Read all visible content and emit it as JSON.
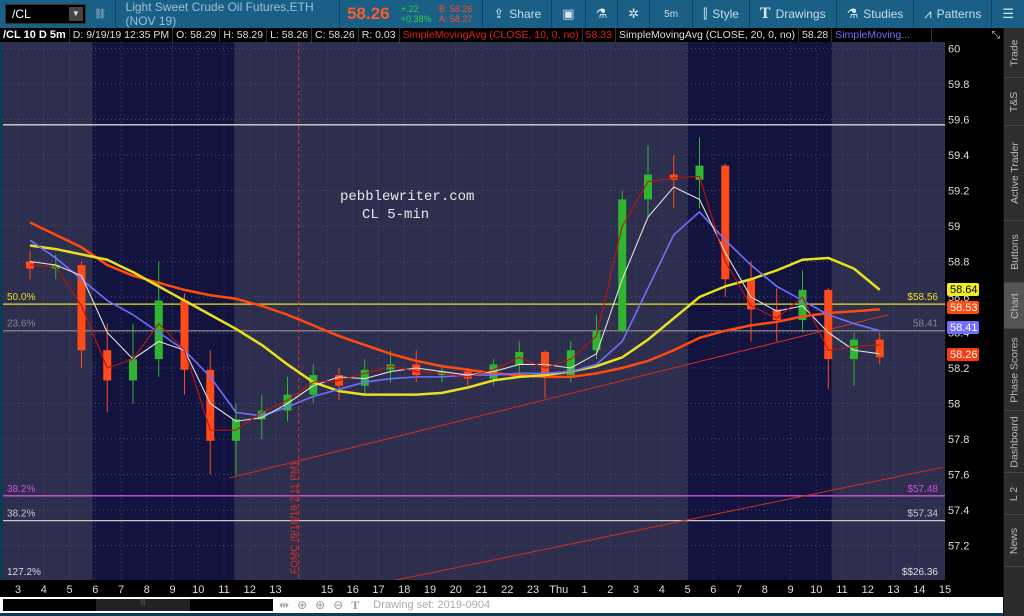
{
  "toolbar": {
    "symbol": "/CL",
    "description": "Light Sweet Crude Oil Futures,ETH (NOV 19)",
    "last": "58.26",
    "change": "+.22",
    "change_pct": "+0.38%",
    "bid": "B: 58.26",
    "ask": "A: 58.27",
    "share": "Share",
    "timeframe": "5m",
    "style": "Style",
    "drawings": "Drawings",
    "studies": "Studies",
    "patterns": "Patterns"
  },
  "status": {
    "title": "/CL 10 D 5m",
    "date": "D: 9/19/19 12:35 PM",
    "open": "O: 58.29",
    "high": "H: 58.29",
    "low": "L: 58.26",
    "close": "C: 58.26",
    "range": "R: 0.03",
    "study1": "SimpleMovingAvg (CLOSE, 10, 0, no)",
    "study1_value": "58.33",
    "study2": "SimpleMovingAvg (CLOSE, 20, 0, no)",
    "study2_value": "58.28",
    "study3": "SimpleMoving..."
  },
  "sidebar": [
    "Trade",
    "T&S",
    "Active Trader",
    "Buttons",
    "Chart",
    "Phase Scores",
    "Dashboard",
    "L 2",
    "News"
  ],
  "sidebar_selected": "Chart",
  "bottom": {
    "drawing_set": "Drawing set: 2019-0904"
  },
  "watermark": [
    "pebblewriter.com",
    "CL 5-min"
  ],
  "chart_data": {
    "type": "candlestick",
    "colors": {
      "background": "#2e2e4e",
      "session_band": "#13133f",
      "up": "#2fb52f",
      "down": "#ff4a1a"
    },
    "ylim": [
      57.0,
      60.0
    ],
    "y_ticks": [
      60,
      59.8,
      59.6,
      59.4,
      59.2,
      59,
      58.8,
      58.6,
      58.4,
      58.2,
      58,
      57.8,
      57.6,
      57.4,
      57.2
    ],
    "x_labels": [
      "3",
      "4",
      "5",
      "6",
      "7",
      "8",
      "9",
      "10",
      "11",
      "12",
      "13",
      "",
      "15",
      "16",
      "17",
      "18",
      "19",
      "20",
      "21",
      "22",
      "23",
      "Thu",
      "1",
      "2",
      "3",
      "4",
      "5",
      "6",
      "7",
      "8",
      "9",
      "10",
      "11",
      "12",
      "13",
      "14",
      "15"
    ],
    "session_bands": [
      [
        2.9,
        8.4
      ],
      [
        26.0,
        31.6
      ]
    ],
    "ohlc": [
      [
        58.8,
        58.86,
        58.7,
        58.76
      ],
      [
        58.76,
        58.84,
        58.7,
        58.78
      ],
      [
        58.78,
        58.8,
        58.2,
        58.3
      ],
      [
        58.3,
        58.45,
        57.95,
        58.13
      ],
      [
        58.13,
        58.45,
        58.0,
        58.25
      ],
      [
        58.25,
        58.8,
        58.15,
        58.58
      ],
      [
        58.58,
        58.62,
        58.05,
        58.19
      ],
      [
        58.19,
        58.3,
        57.6,
        57.79
      ],
      [
        57.79,
        58.0,
        57.6,
        57.91
      ],
      [
        57.91,
        58.05,
        57.8,
        57.96
      ],
      [
        57.96,
        58.15,
        57.9,
        58.05
      ],
      [
        58.05,
        58.22,
        58.0,
        58.16
      ],
      [
        58.16,
        58.2,
        58.02,
        58.1
      ],
      [
        58.1,
        58.25,
        58.05,
        58.19
      ],
      [
        58.19,
        58.3,
        58.12,
        58.22
      ],
      [
        58.22,
        58.3,
        58.12,
        58.16
      ],
      [
        58.16,
        58.22,
        58.12,
        58.18
      ],
      [
        58.18,
        58.2,
        58.1,
        58.14
      ],
      [
        58.14,
        58.25,
        58.1,
        58.22
      ],
      [
        58.22,
        58.35,
        58.15,
        58.29
      ],
      [
        58.29,
        58.3,
        58.03,
        58.16
      ],
      [
        58.16,
        58.35,
        58.12,
        58.3
      ],
      [
        58.3,
        58.5,
        58.25,
        58.41
      ],
      [
        58.41,
        59.2,
        58.4,
        59.15
      ],
      [
        59.15,
        59.45,
        59.05,
        59.29
      ],
      [
        59.29,
        59.4,
        59.1,
        59.26
      ],
      [
        59.26,
        59.5,
        59.1,
        59.34
      ],
      [
        59.34,
        59.35,
        58.6,
        58.7
      ],
      [
        58.7,
        58.8,
        58.35,
        58.53
      ],
      [
        58.53,
        58.65,
        58.35,
        58.47
      ],
      [
        58.47,
        58.75,
        58.4,
        58.64
      ],
      [
        58.64,
        58.65,
        58.08,
        58.25
      ],
      [
        58.25,
        58.4,
        58.1,
        58.36
      ],
      [
        58.36,
        58.4,
        58.22,
        58.26
      ]
    ],
    "series": [
      {
        "color": "#ff4a10",
        "values": [
          59.02,
          58.95,
          58.88,
          58.78,
          58.72,
          58.68,
          58.64,
          58.61,
          58.59,
          58.55,
          58.5,
          58.44,
          58.38,
          58.33,
          58.28,
          58.24,
          58.21,
          58.19,
          58.17,
          58.16,
          58.15,
          58.15,
          58.17,
          58.2,
          58.24,
          58.3,
          58.37,
          58.41,
          58.44,
          58.46,
          58.49,
          58.51,
          58.52,
          58.53
        ]
      },
      {
        "color": "#e8e020",
        "values": [
          58.89,
          58.87,
          58.84,
          58.81,
          58.74,
          58.66,
          58.58,
          58.5,
          58.42,
          58.33,
          58.22,
          58.12,
          58.07,
          58.05,
          58.05,
          58.05,
          58.06,
          58.09,
          58.13,
          58.15,
          58.16,
          58.18,
          58.21,
          58.26,
          58.36,
          58.48,
          58.6,
          58.66,
          58.7,
          58.75,
          58.81,
          58.82,
          58.76,
          58.64
        ]
      },
      {
        "color": "#6f6fff",
        "values": [
          58.92,
          58.82,
          58.7,
          58.58,
          58.5,
          58.4,
          58.3,
          58.15,
          57.95,
          57.93,
          57.98,
          58.04,
          58.08,
          58.12,
          58.14,
          58.15,
          58.15,
          58.16,
          58.16,
          58.17,
          58.17,
          58.18,
          58.22,
          58.35,
          58.65,
          58.95,
          59.08,
          58.92,
          58.78,
          58.66,
          58.58,
          58.5,
          58.45,
          58.41
        ]
      },
      {
        "name": "SimpleMovingAvg (CLOSE, 20, 0, no)",
        "color": "#e0e0e0",
        "values": [
          58.8,
          58.78,
          58.72,
          58.4,
          58.25,
          58.35,
          58.3,
          58.0,
          57.9,
          57.92,
          58.0,
          58.1,
          58.15,
          58.14,
          58.18,
          58.2,
          58.18,
          58.16,
          58.18,
          58.22,
          58.22,
          58.2,
          58.28,
          58.7,
          59.05,
          59.22,
          59.15,
          58.85,
          58.6,
          58.52,
          58.55,
          58.4,
          58.3,
          58.28
        ]
      },
      {
        "name": "SimpleMovingAvg (CLOSE, 10, 0, no)",
        "color": "#c0140c",
        "values": [
          58.78,
          58.77,
          58.55,
          58.2,
          58.25,
          58.45,
          58.3,
          57.85,
          57.85,
          57.95,
          58.02,
          58.12,
          58.13,
          58.17,
          58.21,
          58.18,
          58.17,
          58.15,
          58.19,
          58.26,
          58.2,
          58.25,
          58.38,
          59.0,
          59.25,
          59.27,
          59.28,
          58.8,
          58.55,
          58.48,
          58.6,
          58.3,
          58.32,
          58.33
        ]
      }
    ],
    "levels": [
      {
        "price": 59.57,
        "color": "#d8d8d8",
        "left_label": "",
        "right_label": ""
      },
      {
        "price": 58.56,
        "color": "#e8e020",
        "left_label": "50.0%",
        "right_label": "$58.56"
      },
      {
        "price": 58.41,
        "color": "#8a8a8a",
        "left_label": "23.6%",
        "right_label": "58.41"
      },
      {
        "price": 57.48,
        "color": "#d050e0",
        "left_label": "38.2%",
        "right_label": "$57.48"
      },
      {
        "price": 57.34,
        "color": "#c8c8c8",
        "left_label": "38.2%",
        "right_label": "$57.34"
      }
    ],
    "offchart_label": {
      "left": "127.2%",
      "right": "$$26.36"
    },
    "trendlines": [
      {
        "color": "#d03020",
        "from": [
          8.2,
          57.58
        ],
        "to": [
          33.8,
          58.5
        ]
      },
      {
        "color": "#d03020",
        "from": [
          14.5,
          57.0
        ],
        "to": [
          35.9,
          57.64
        ]
      }
    ],
    "event_line": {
      "at": 10.9,
      "label": "FOMC (9/18/19 2:11 PM)",
      "color": "#e03020"
    },
    "axis_badges": [
      {
        "value": "58.64",
        "color": "#f0f020",
        "text_color": "#000"
      },
      {
        "value": "58.53",
        "color": "#ff4a10",
        "text_color": "#fff"
      },
      {
        "value": "58.41",
        "color": "#6f6fff",
        "text_color": "#fff"
      },
      {
        "value": "58.26",
        "color": "#ff3a10",
        "text_color": "#fff"
      }
    ]
  }
}
